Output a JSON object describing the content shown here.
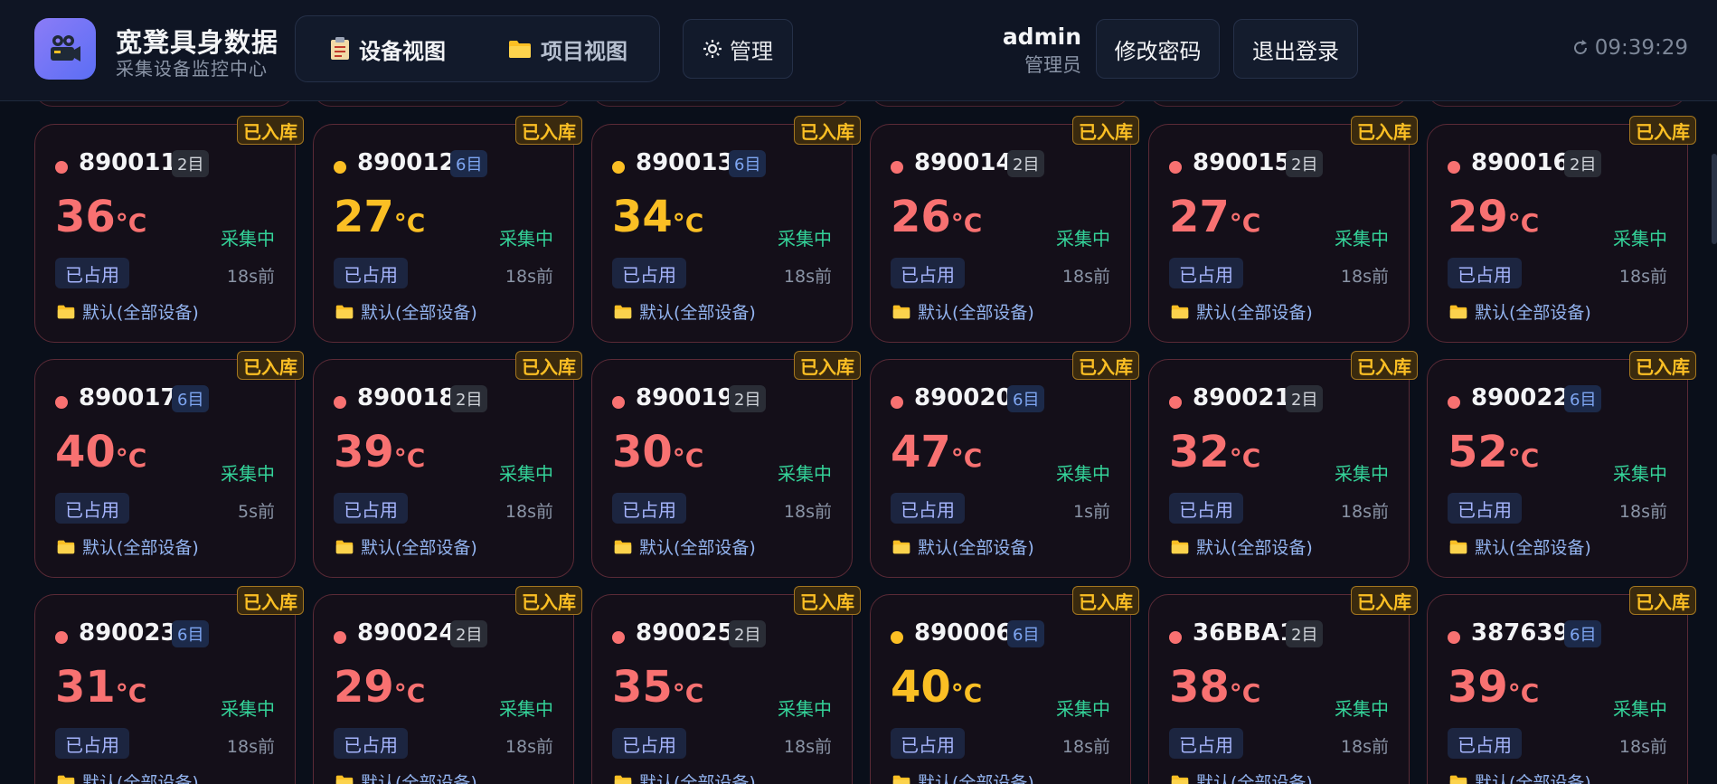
{
  "header": {
    "brand_title": "宽凳具身数据",
    "brand_subtitle": "采集设备监控中心",
    "views": [
      {
        "label": "设备视图",
        "icon": "clipboard-icon",
        "active": true
      },
      {
        "label": "项目视图",
        "icon": "folder-icon",
        "active": false
      }
    ],
    "manage_label": "管理",
    "user_name": "admin",
    "user_role": "管理员",
    "change_password_label": "修改密码",
    "logout_label": "退出登录",
    "clock": "09:39:29"
  },
  "colors": {
    "temp_hot": "#f87171",
    "temp_warm": "#fbbf24",
    "dot_hot": "#f87171",
    "dot_warm": "#fbbf24",
    "status_green": "#34d399",
    "stock_tag": "#fbbf24"
  },
  "card_common": {
    "stock_label": "已入库",
    "status_label": "采集中",
    "occupied_label": "已占用",
    "group_label": "默认(全部设备)",
    "temp_unit": "°C"
  },
  "devices": [
    {
      "id": "890011",
      "eyes": "2目",
      "temp": "36",
      "ago": "18s前",
      "level": "hot"
    },
    {
      "id": "890012",
      "eyes": "6目",
      "temp": "27",
      "ago": "18s前",
      "level": "warm"
    },
    {
      "id": "890013",
      "eyes": "6目",
      "temp": "34",
      "ago": "18s前",
      "level": "warm"
    },
    {
      "id": "890014",
      "eyes": "2目",
      "temp": "26",
      "ago": "18s前",
      "level": "hot"
    },
    {
      "id": "890015",
      "eyes": "2目",
      "temp": "27",
      "ago": "18s前",
      "level": "hot"
    },
    {
      "id": "890016",
      "eyes": "2目",
      "temp": "29",
      "ago": "18s前",
      "level": "hot"
    },
    {
      "id": "890017",
      "eyes": "6目",
      "temp": "40",
      "ago": "5s前",
      "level": "hot"
    },
    {
      "id": "890018",
      "eyes": "2目",
      "temp": "39",
      "ago": "18s前",
      "level": "hot"
    },
    {
      "id": "890019",
      "eyes": "2目",
      "temp": "30",
      "ago": "18s前",
      "level": "hot"
    },
    {
      "id": "890020",
      "eyes": "6目",
      "temp": "47",
      "ago": "1s前",
      "level": "hot"
    },
    {
      "id": "890021",
      "eyes": "2目",
      "temp": "32",
      "ago": "18s前",
      "level": "hot"
    },
    {
      "id": "890022",
      "eyes": "6目",
      "temp": "52",
      "ago": "18s前",
      "level": "hot"
    },
    {
      "id": "890023",
      "eyes": "6目",
      "temp": "31",
      "ago": "18s前",
      "level": "hot"
    },
    {
      "id": "890024",
      "eyes": "2目",
      "temp": "29",
      "ago": "18s前",
      "level": "hot"
    },
    {
      "id": "890025",
      "eyes": "2目",
      "temp": "35",
      "ago": "18s前",
      "level": "hot"
    },
    {
      "id": "890006",
      "eyes": "6目",
      "temp": "40",
      "ago": "18s前",
      "level": "warm"
    },
    {
      "id": "36BBA1",
      "eyes": "2目",
      "temp": "38",
      "ago": "18s前",
      "level": "hot"
    },
    {
      "id": "387639",
      "eyes": "6目",
      "temp": "39",
      "ago": "18s前",
      "level": "hot"
    }
  ]
}
